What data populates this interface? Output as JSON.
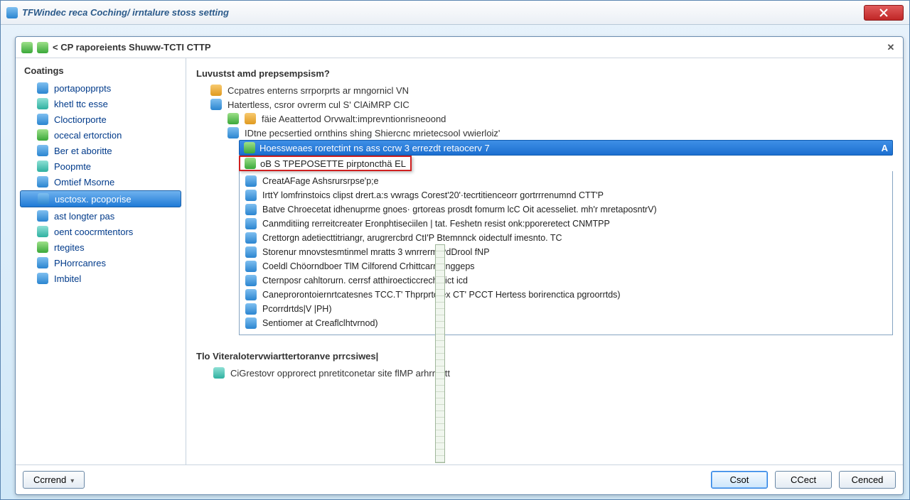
{
  "outer_title": "TFWindec reca Coching/ irntalure stoss setting",
  "inner_title": "< CP raporeients Shuww-TCTI CTTP",
  "sidebar": {
    "header": "Coatings",
    "items": [
      "portapopprpts",
      "khetl ttc esse",
      "Cloctiorporte",
      "ocecal ertorction",
      "Ber et aboritte",
      "Poopmte",
      "Omtief Msorne",
      "usctosx. pcoporise",
      "ast longter pas",
      "oent coocrmtentors",
      "rtegites",
      "PHorrcanres",
      "Imbitel"
    ],
    "selected_index": 7
  },
  "main": {
    "heading": "Luvustst amd prepsempsism?",
    "lines": [
      "Ccpatres enterns srrporprts ar mngornicl VN",
      "Hatertless, csror ovrerm cul S' ClAiMRP CIC",
      "fäie Aeattertod Orvwalt:imprevntionrisneoond",
      "IDtne pecsertied ornthins shing Shiercnc mrietecsool vwierloiz'"
    ],
    "selected_row": {
      "text": "Hoessweaes roretctint ns ass ccrw 3 errezdt retaocerv 7",
      "badge": "A"
    },
    "highlight": "oB S TPEPOSETTE pirptoncthä EL",
    "list_rows": [
      "CreatAFage Ashsrursrpse'p;e",
      "IrttY lomfrinstoics clipst drert.a:s vwrags Corest'20'·tecrtitienceorr gortrrrenumnd CTT'P",
      "Batve Chroecetat idhenuprme gnoes· grtoreas prosdt fomurm lcC Oit acesseliet. mh'r mretaposntrV)",
      "Canmditiing rerreitcreater Eronphtiseciilen | tat. Feshetn resist onk:pporeretect CNMTPP",
      "Crettorgn adetiecttitriangr, arugrercbrd CtI'P Btemnnck oidectulf imesnto. TC",
      "Storenur mnovstesmtinmel mratts 3 wnrrerm PdDrool fNP",
      "Coeldl Chöorndboer TlM Cilforend Crhittcarmenggeps",
      "Cternposr cahltorurn. cerrsf atthiroecticcrechtbict icd",
      "Caneprorontoiernrtcatesnes TCC.T' Thprprtotex CT' PCCT Hertess borirenctica pgroorrtds)",
      "Pcorrdrtds|V |PH)",
      "Sentiomer at Creaflclhtvrnod)"
    ],
    "footer_label": "Tlo Viteralotervwiarttertoranve prrcsiwes|",
    "footer_line": "CiGrestovr opprorect pnretitconetar site flMP arhrritett"
  },
  "buttons": {
    "left": "Ccrrend",
    "ok": "Csot",
    "mid": "CCect",
    "cancel": "Cenced"
  }
}
